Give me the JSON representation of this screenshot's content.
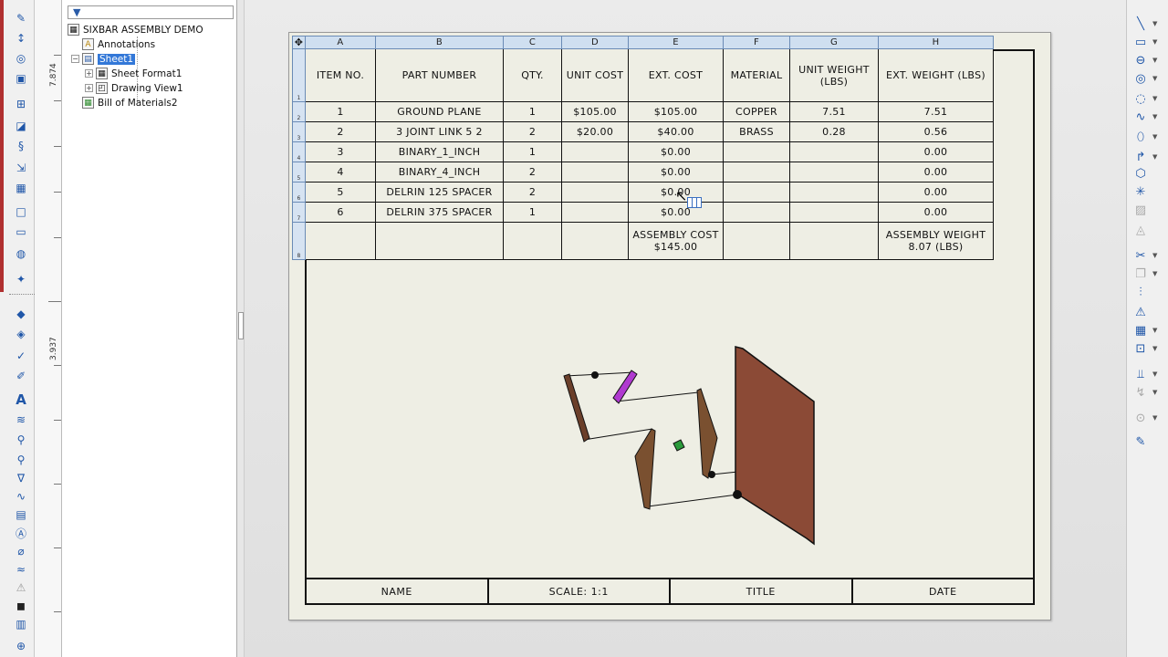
{
  "ruler": {
    "upper_label": "7.874",
    "lower_label": "3.937"
  },
  "tree": {
    "root": "SIXBAR ASSEMBLY DEMO",
    "annotations": "Annotations",
    "sheet": "Sheet1",
    "sheet_format": "Sheet Format1",
    "drawing_view": "Drawing View1",
    "bom": "Bill of Materials2"
  },
  "bom": {
    "column_letters": [
      "A",
      "B",
      "C",
      "D",
      "E",
      "F",
      "G",
      "H"
    ],
    "headers": [
      "ITEM NO.",
      "PART NUMBER",
      "QTY.",
      "UNIT COST",
      "EXT. COST",
      "MATERIAL",
      "UNIT WEIGHT (LBS)",
      "EXT. WEIGHT (LBS)"
    ],
    "rows": [
      [
        "1",
        "GROUND PLANE",
        "1",
        "$105.00",
        "$105.00",
        "COPPER",
        "7.51",
        "7.51"
      ],
      [
        "2",
        "3 JOINT LINK 5 2",
        "2",
        "$20.00",
        "$40.00",
        "BRASS",
        "0.28",
        "0.56"
      ],
      [
        "3",
        "BINARY_1_INCH",
        "1",
        "",
        "$0.00",
        "",
        "",
        "0.00"
      ],
      [
        "4",
        "BINARY_4_INCH",
        "2",
        "",
        "$0.00",
        "",
        "",
        "0.00"
      ],
      [
        "5",
        "DELRIN 125 SPACER",
        "2",
        "",
        "$0.00",
        "",
        "",
        "0.00"
      ],
      [
        "6",
        "DELRIN 375 SPACER",
        "1",
        "",
        "$0.00",
        "",
        "",
        "0.00"
      ]
    ],
    "total_cost": "ASSEMBLY COST $145.00",
    "total_weight": "ASSEMBLY WEIGHT 8.07 (LBS)"
  },
  "title_block": {
    "name": "NAME",
    "scale": "SCALE: 1:1",
    "title": "TITLE",
    "date": "DATE"
  },
  "colors": {
    "selection": "#3378d8",
    "table_header": "#cfdff0",
    "sheet": "#eeeee4",
    "copper": "#8b4a36",
    "brass": "#6a4a2a",
    "magenta": "#b03ad0"
  },
  "icons": {
    "left": [
      "sketch-icon",
      "smart-dimension-icon",
      "line-icon",
      "rectangle-icon",
      "circle-icon",
      "arc-icon",
      "note-icon",
      "balloon-icon",
      "text-icon",
      "spell-check-icon",
      "weld-icon",
      "datum-icon",
      "surface-finish-icon",
      "centerline-icon",
      "hole-callout-icon",
      "table-icon",
      "hatch-icon"
    ],
    "right": [
      "line-icon",
      "rectangle-icon",
      "slot-icon",
      "circle-icon",
      "arc-icon",
      "spline-icon",
      "ellipse-icon",
      "fillet-icon",
      "polygon-icon",
      "point-icon",
      "mirror-icon",
      "offset-icon",
      "trim-icon",
      "convert-icon",
      "pattern-icon",
      "move-icon",
      "relations-icon",
      "display-icon"
    ]
  }
}
